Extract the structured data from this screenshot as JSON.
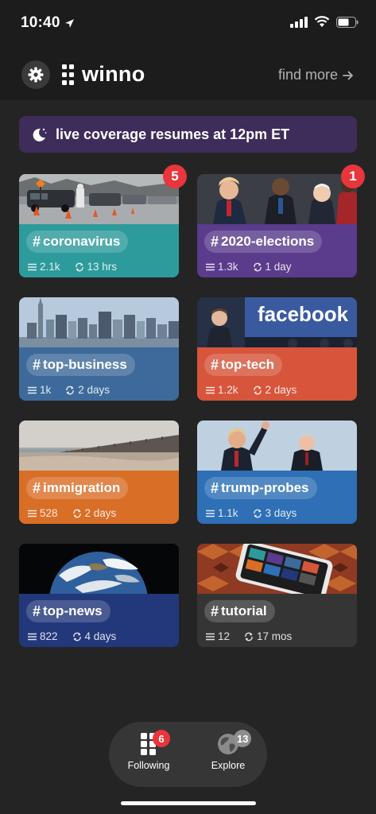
{
  "status_bar": {
    "time": "10:40",
    "icons": [
      "location-arrow-icon",
      "signal-icon",
      "wifi-icon",
      "battery-icon"
    ]
  },
  "header": {
    "logo_text": "winno",
    "find_more_label": "find more",
    "icons": [
      "gear-icon",
      "winno-logo-icon",
      "arrow-right-icon"
    ]
  },
  "live_banner": {
    "text": "live coverage resumes at 12pm ET",
    "icon": "moon-icon"
  },
  "cards": [
    {
      "tag": "coronavirus",
      "count": "2.1k",
      "time": "13 hrs",
      "badge": "5",
      "color": "#2d9a9b"
    },
    {
      "tag": "2020-elections",
      "count": "1.3k",
      "time": "1 day",
      "badge": "1",
      "color": "#5a3b8c"
    },
    {
      "tag": "top-business",
      "count": "1k",
      "time": "2 days",
      "badge": "",
      "color": "#3d6a9a"
    },
    {
      "tag": "top-tech",
      "count": "1.2k",
      "time": "2 days",
      "badge": "",
      "color": "#d6553b"
    },
    {
      "tag": "immigration",
      "count": "528",
      "time": "2 days",
      "badge": "",
      "color": "#d96e27"
    },
    {
      "tag": "trump-probes",
      "count": "1.1k",
      "time": "3 days",
      "badge": "",
      "color": "#2e6fb5"
    },
    {
      "tag": "top-news",
      "count": "822",
      "time": "4 days",
      "badge": "",
      "color": "#22387a"
    },
    {
      "tag": "tutorial",
      "count": "12",
      "time": "17 mos",
      "badge": "",
      "color": "#353535"
    }
  ],
  "card_meta_icons": [
    "list-icon",
    "refresh-icon"
  ],
  "bottom_nav": {
    "following_label": "Following",
    "following_badge": "6",
    "explore_label": "Explore",
    "explore_badge": "13"
  },
  "image_text": {
    "facebook_sign": "facebook"
  }
}
